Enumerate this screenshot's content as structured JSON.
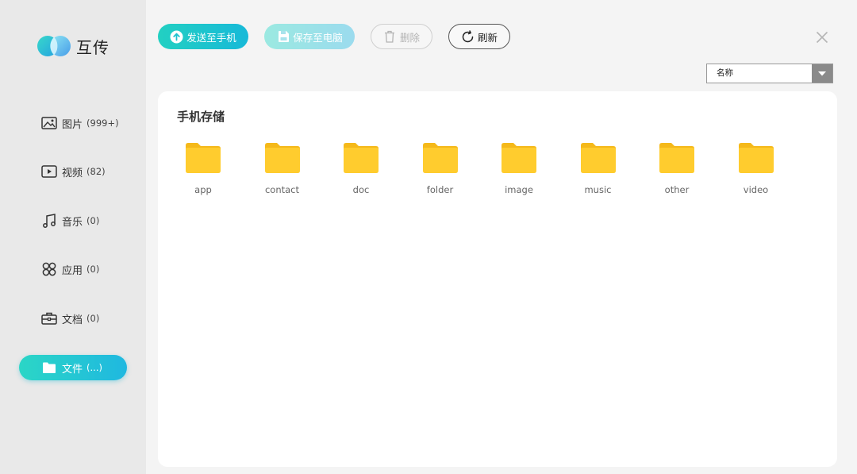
{
  "app": {
    "name": "互传"
  },
  "sidebar": {
    "items": [
      {
        "label": "图片",
        "count": "(999+)",
        "icon": "image-icon"
      },
      {
        "label": "视频",
        "count": "(82)",
        "icon": "video-icon"
      },
      {
        "label": "音乐",
        "count": "(0)",
        "icon": "music-icon"
      },
      {
        "label": "应用",
        "count": "(0)",
        "icon": "apps-icon"
      },
      {
        "label": "文档",
        "count": "(0)",
        "icon": "briefcase-icon"
      },
      {
        "label": "文件",
        "count": "(...)",
        "icon": "folder-icon",
        "active": true
      }
    ]
  },
  "toolbar": {
    "send_label": "发送至手机",
    "save_label": "保存至电脑",
    "delete_label": "删除",
    "refresh_label": "刷新"
  },
  "sort": {
    "selected": "名称"
  },
  "main": {
    "title": "手机存储",
    "folders": [
      "app",
      "contact",
      "doc",
      "folder",
      "image",
      "music",
      "other",
      "video"
    ]
  },
  "colors": {
    "accent_start": "#22d0c2",
    "accent_end": "#17b9d8",
    "folder": "#ffcc2e",
    "folder_tab": "#f5b91a"
  }
}
